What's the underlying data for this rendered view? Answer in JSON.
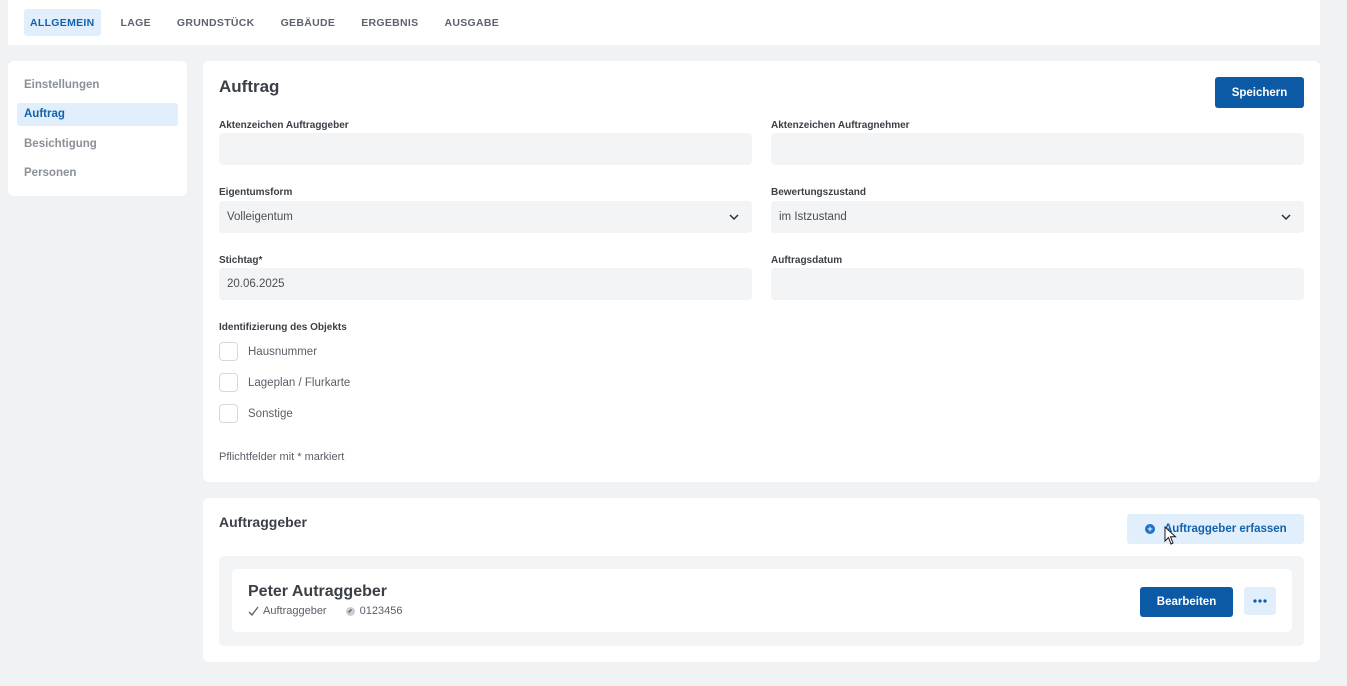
{
  "tabs": [
    {
      "label": "ALLGEMEIN",
      "active": true
    },
    {
      "label": "LAGE"
    },
    {
      "label": "GRUNDSTÜCK"
    },
    {
      "label": "GEBÄUDE"
    },
    {
      "label": "ERGEBNIS"
    },
    {
      "label": "AUSGABE"
    }
  ],
  "sidebar": {
    "items": [
      {
        "label": "Einstellungen"
      },
      {
        "label": "Auftrag",
        "active": true
      },
      {
        "label": "Besichtigung"
      },
      {
        "label": "Personen"
      }
    ]
  },
  "auftrag": {
    "title": "Auftrag",
    "save_label": "Speichern",
    "fields": {
      "aktenzeichen_auftraggeber": {
        "label": "Aktenzeichen Auftraggeber",
        "value": ""
      },
      "aktenzeichen_auftragnehmer": {
        "label": "Aktenzeichen Auftragnehmer",
        "value": ""
      },
      "eigentumsform": {
        "label": "Eigentumsform",
        "value": "Volleigentum"
      },
      "bewertungszustand": {
        "label": "Bewertungszustand",
        "value": "im Istzustand"
      },
      "stichtag": {
        "label": "Stichtag*",
        "value": "20.06.2025"
      },
      "auftragsdatum": {
        "label": "Auftragsdatum",
        "value": ""
      }
    },
    "identifizierung": {
      "label": "Identifizierung des Objekts",
      "options": [
        {
          "label": "Hausnummer",
          "checked": false
        },
        {
          "label": "Lageplan / Flurkarte",
          "checked": false
        },
        {
          "label": "Sonstige",
          "checked": false
        }
      ]
    },
    "hint": "Pflichtfelder mit * markiert"
  },
  "auftraggeber": {
    "title": "Auftraggeber",
    "add_label": "Auftraggeber erfassen",
    "person": {
      "name": "Peter Autraggeber",
      "role": "Auftraggeber",
      "number": "0123456",
      "edit_label": "Bearbeiten"
    }
  },
  "colors": {
    "primary": "#0c5aa6",
    "accent_bg": "#e1eefb",
    "accent_text": "#1462ad",
    "page_bg": "#f1f2f4"
  }
}
